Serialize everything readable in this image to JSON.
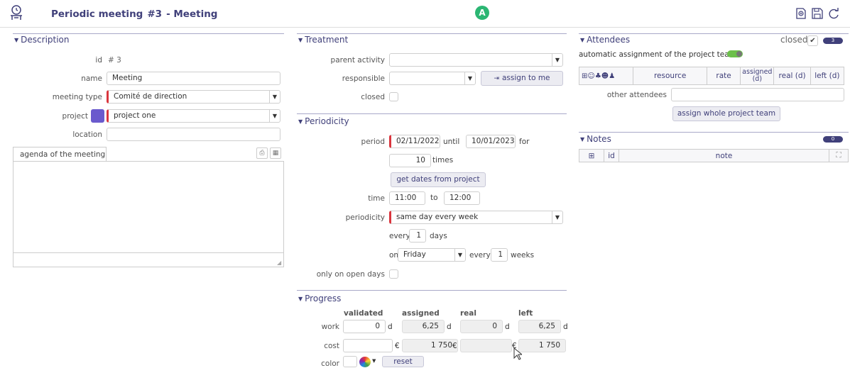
{
  "header": {
    "title": "Periodic meeting",
    "number": "#3",
    "separator": "- Meeting",
    "avatar_letter": "A",
    "avatar_color": "#2bb673"
  },
  "description": {
    "section_title": "Description",
    "id_label": "id",
    "id_value": "# 3",
    "name_label": "name",
    "name_value": "Meeting",
    "meeting_type_label": "meeting type",
    "meeting_type_value": "Comité de direction",
    "project_label": "project",
    "project_value": "project one",
    "project_color": "#6a5acd",
    "location_label": "location",
    "location_value": "",
    "agenda_tab": "agenda of the meeting"
  },
  "treatment": {
    "section_title": "Treatment",
    "parent_activity_label": "parent activity",
    "parent_activity_value": "",
    "responsible_label": "responsible",
    "responsible_value": "",
    "assign_to_me": "assign to me",
    "closed_label": "closed"
  },
  "periodicity": {
    "section_title": "Periodicity",
    "period_label": "period",
    "period_start": "02/11/2022",
    "until_label": "until",
    "period_end": "10/01/2023",
    "for_label": "for",
    "times_value": "10",
    "times_label": "times",
    "get_dates_button": "get dates from project",
    "time_label": "time",
    "time_start": "11:00",
    "to_label": "to",
    "time_end": "12:00",
    "periodicity_label": "periodicity",
    "periodicity_value": "same day every week",
    "every_label": "every",
    "every_days_value": "1",
    "days_label": "days",
    "on_label": "on",
    "on_day_value": "Friday",
    "every2_label": "every",
    "every_weeks_value": "1",
    "weeks_label": "weeks",
    "only_open_days_label": "only on open days"
  },
  "progress": {
    "section_title": "Progress",
    "headers": [
      "validated",
      "assigned",
      "real",
      "left"
    ],
    "work_label": "work",
    "work": {
      "validated": "0",
      "assigned": "6,25",
      "real": "0",
      "left": "6,25",
      "unit": "d"
    },
    "cost_label": "cost",
    "cost": {
      "validated": "",
      "assigned": "1 750",
      "real": "",
      "left": "1 750",
      "unit": "€"
    },
    "color_label": "color",
    "reset_button": "reset"
  },
  "attendees": {
    "section_title": "Attendees",
    "closed_label": "closed",
    "count": "3",
    "auto_assign_label": "automatic assignment of the project team",
    "columns": [
      "resource",
      "rate",
      "assigned (d)",
      "real (d)",
      "left (d)"
    ],
    "other_attendees_label": "other attendees",
    "assign_team_button": "assign whole project team"
  },
  "notes": {
    "section_title": "Notes",
    "count": "0",
    "columns": [
      "id",
      "note"
    ]
  }
}
